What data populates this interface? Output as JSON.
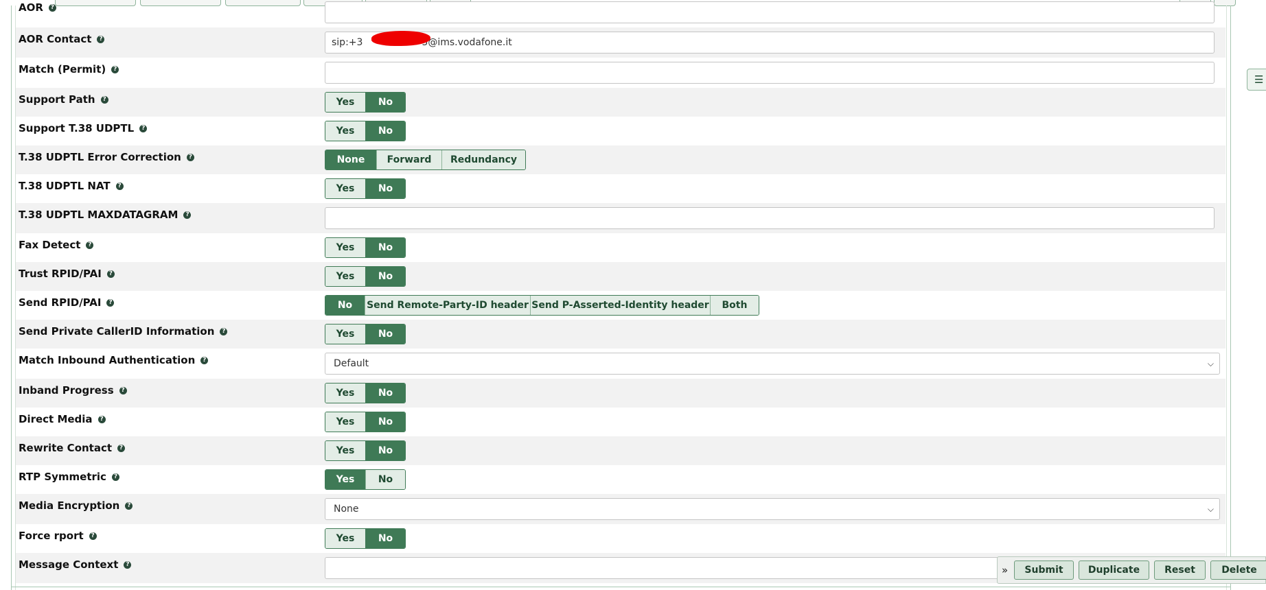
{
  "fields": {
    "aor": {
      "label": "AOR",
      "value": ""
    },
    "aor_contact": {
      "label": "AOR Contact",
      "value_prefix": "sip:+3",
      "value_suffix": "5@ims.vodafone.it"
    },
    "match_permit": {
      "label": "Match (Permit)",
      "value": ""
    },
    "support_path": {
      "label": "Support Path",
      "options": [
        "Yes",
        "No"
      ],
      "selected": "No"
    },
    "support_t38": {
      "label": "Support T.38 UDPTL",
      "options": [
        "Yes",
        "No"
      ],
      "selected": "No"
    },
    "t38_error_correction": {
      "label": "T.38 UDPTL Error Correction",
      "options": [
        "None",
        "Forward",
        "Redundancy"
      ],
      "selected": "None"
    },
    "t38_nat": {
      "label": "T.38 UDPTL NAT",
      "options": [
        "Yes",
        "No"
      ],
      "selected": "No"
    },
    "t38_maxdatagram": {
      "label": "T.38 UDPTL MAXDATAGRAM",
      "value": ""
    },
    "fax_detect": {
      "label": "Fax Detect",
      "options": [
        "Yes",
        "No"
      ],
      "selected": "No"
    },
    "trust_rpid": {
      "label": "Trust RPID/PAI",
      "options": [
        "Yes",
        "No"
      ],
      "selected": "No"
    },
    "send_rpid": {
      "label": "Send RPID/PAI",
      "options": [
        "No",
        "Send Remote-Party-ID header",
        "Send P-Asserted-Identity header",
        "Both"
      ],
      "selected": "No"
    },
    "send_private_callerid": {
      "label": "Send Private CallerID Information",
      "options": [
        "Yes",
        "No"
      ],
      "selected": "No"
    },
    "match_inbound_auth": {
      "label": "Match Inbound Authentication",
      "value": "Default"
    },
    "inband_progress": {
      "label": "Inband Progress",
      "options": [
        "Yes",
        "No"
      ],
      "selected": "No"
    },
    "direct_media": {
      "label": "Direct Media",
      "options": [
        "Yes",
        "No"
      ],
      "selected": "No"
    },
    "rewrite_contact": {
      "label": "Rewrite Contact",
      "options": [
        "Yes",
        "No"
      ],
      "selected": "No"
    },
    "rtp_symmetric": {
      "label": "RTP Symmetric",
      "options": [
        "Yes",
        "No"
      ],
      "selected": "Yes"
    },
    "media_encryption": {
      "label": "Media Encryption",
      "value": "None"
    },
    "force_rport": {
      "label": "Force rport",
      "options": [
        "Yes",
        "No"
      ],
      "selected": "No"
    },
    "message_context": {
      "label": "Message Context",
      "value": ""
    }
  },
  "help_glyph": "?",
  "actions": {
    "toggle": "»",
    "submit": "Submit",
    "duplicate": "Duplicate",
    "reset": "Reset",
    "delete": "Delete"
  },
  "icons": {
    "float": "list-icon",
    "help": "question-circle-icon",
    "select": "chevron-down-icon"
  },
  "colors": {
    "accent": "#3f7a56",
    "accent_light": "#e3ede6",
    "row_alt": "#f2f2f2",
    "redaction": "#ee0000"
  }
}
